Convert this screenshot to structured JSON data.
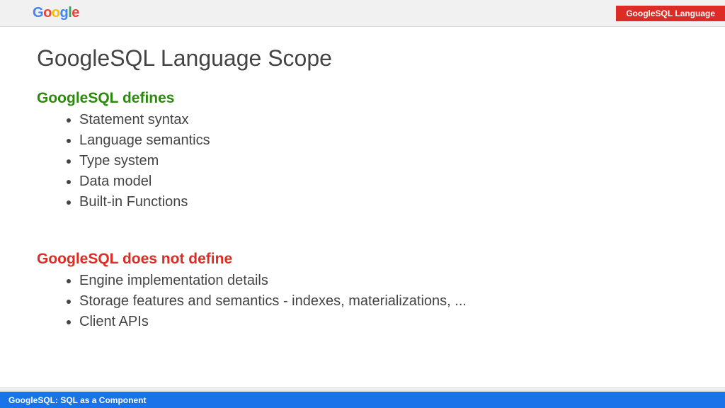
{
  "header": {
    "tag": "GoogleSQL Language"
  },
  "title": "GoogleSQL Language Scope",
  "section1": {
    "heading": "GoogleSQL defines",
    "items": [
      "Statement syntax",
      "Language semantics",
      "Type system",
      "Data model",
      "Built-in Functions"
    ]
  },
  "section2": {
    "heading": "GoogleSQL does not define",
    "items": [
      "Engine implementation details",
      "Storage features and semantics - indexes, materializations, ...",
      "Client APIs"
    ]
  },
  "footer": {
    "text": "GoogleSQL: SQL as a Component"
  }
}
